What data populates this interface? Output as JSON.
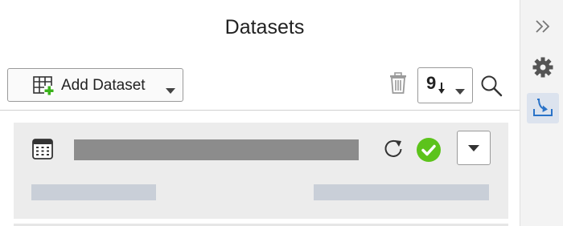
{
  "panel": {
    "title": "Datasets"
  },
  "toolbar": {
    "add_dataset_label": "Add Dataset",
    "sort_label": "9"
  },
  "dataset_item": {
    "status": "success"
  },
  "colors": {
    "success": "#5cc31b",
    "accent": "#2a73c8",
    "placeholder_dark": "#8c8c8c",
    "placeholder_light": "#c9cfd8"
  },
  "icons": {
    "add": "table-plus-icon",
    "delete": "trash-icon",
    "sort": "sort-descending-icon",
    "search": "search-icon",
    "dataset": "table-icon",
    "refresh": "refresh-icon",
    "status": "check-circle-icon",
    "collapse": "double-chevron-right-icon",
    "settings": "gear-icon",
    "download": "download-tray-icon"
  }
}
